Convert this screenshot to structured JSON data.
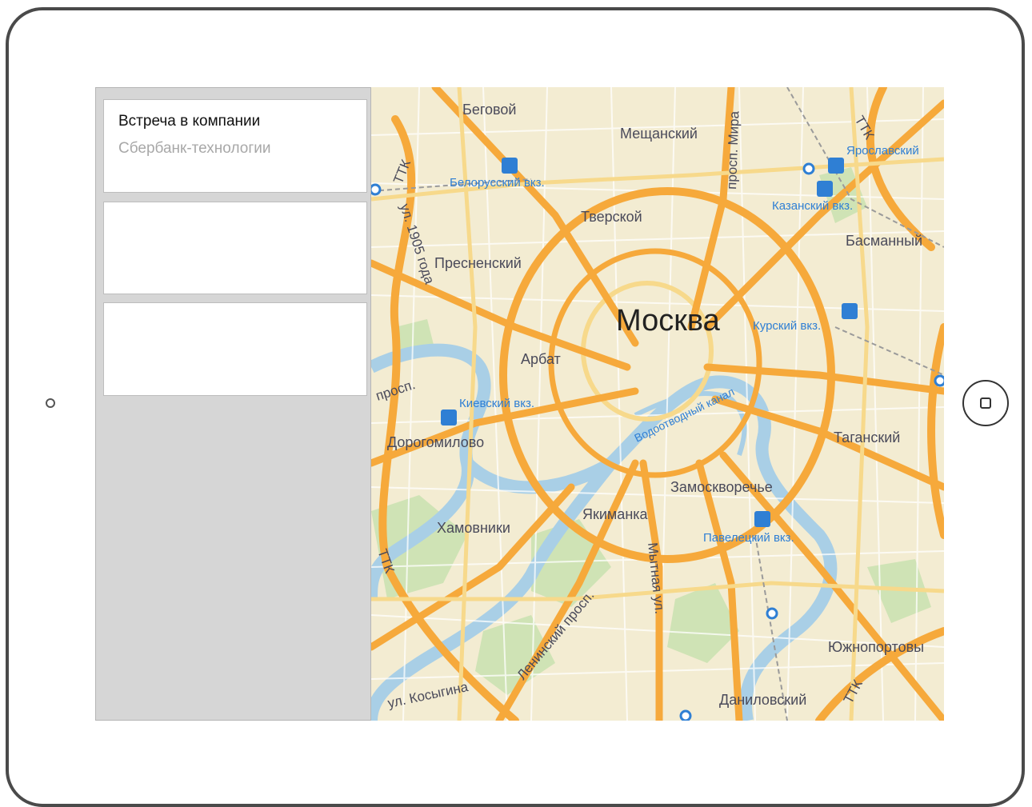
{
  "meetings": [
    {
      "title": "Встреча в компании",
      "subtitle": "Сбербанк-технологии"
    },
    {
      "title": "",
      "subtitle": ""
    },
    {
      "title": "",
      "subtitle": ""
    }
  ],
  "map": {
    "city": "Москва",
    "districts": [
      "Беговой",
      "Мещанский",
      "Тверской",
      "Басманный",
      "Пресненский",
      "Арбат",
      "Дорогомилово",
      "Таганский",
      "Замоскворечье",
      "Якиманка",
      "Хамовники",
      "Южнопортовы",
      "Даниловский"
    ],
    "stations": [
      "Белорусский вкз.",
      "Ярославский",
      "Казанский вкз.",
      "Курский вкз.",
      "Киевский вкз.",
      "Павелецкий вкз."
    ],
    "streets": [
      "ТТК",
      "ТТК",
      "ТТК",
      "ТТК",
      "просп. Мира",
      "ул. 1905 года",
      "просп.",
      "Водоотводный канал",
      "Ленинский просп.",
      "Мытная ул.",
      "ул. Косыгина"
    ]
  },
  "colors": {
    "road": "#f6a93b",
    "road_light": "#f7d98b",
    "water": "#a9cfe6",
    "park": "#cfe3b5",
    "land": "#f3ecd2",
    "label": "#4a4a5a",
    "station": "#2f7fd4"
  }
}
